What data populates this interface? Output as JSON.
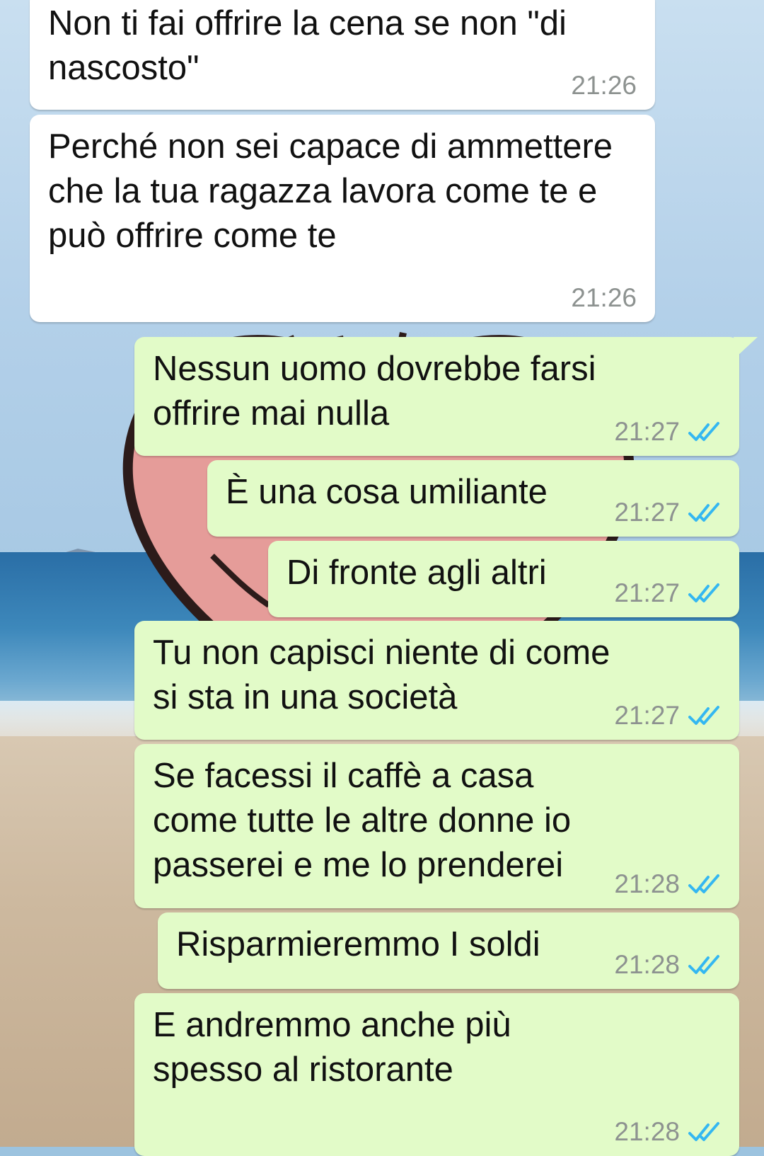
{
  "colors": {
    "incoming_bubble": "#ffffff",
    "outgoing_bubble": "#e2fbc8",
    "timestamp": "#8d9290",
    "read_ticks": "#34b7f1"
  },
  "messages": [
    {
      "direction": "incoming",
      "text": "Non ti fai offrire la cena se non \"di nascosto\"",
      "time": "21:26"
    },
    {
      "direction": "incoming",
      "text": "Perché non sei capace di ammettere che la tua ragazza lavora come te e può offrire come te",
      "time": "21:26"
    },
    {
      "direction": "outgoing",
      "text": "Nessun uomo dovrebbe farsi offrire mai nulla",
      "time": "21:27",
      "status": "read-ticks-icon"
    },
    {
      "direction": "outgoing",
      "text": "È una cosa umiliante",
      "time": "21:27",
      "status": "read-ticks-icon"
    },
    {
      "direction": "outgoing",
      "text": "Di fronte agli altri",
      "time": "21:27",
      "status": "read-ticks-icon"
    },
    {
      "direction": "outgoing",
      "text": "Tu non capisci niente di come si sta in una società",
      "time": "21:27",
      "status": "read-ticks-icon"
    },
    {
      "direction": "outgoing",
      "text": "Se facessi il caffè a casa come tutte le altre donne io passerei e me lo prenderei",
      "time": "21:28",
      "status": "read-ticks-icon"
    },
    {
      "direction": "outgoing",
      "text": "Risparmieremmo I soldi",
      "time": "21:28",
      "status": "read-ticks-icon"
    },
    {
      "direction": "outgoing",
      "text": "E andremmo anche più spesso al ristorante",
      "time": "21:28",
      "status": "read-ticks-icon"
    }
  ]
}
